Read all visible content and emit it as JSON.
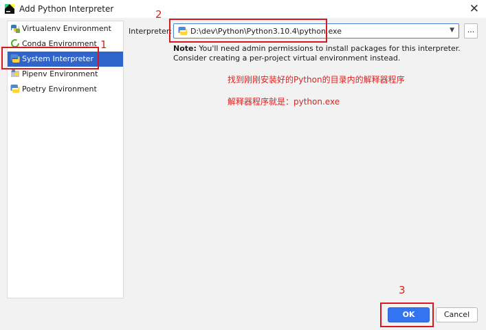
{
  "window": {
    "title": "Add Python Interpreter"
  },
  "sidebar": {
    "items": [
      {
        "label": "Virtualenv Environment",
        "icon": "virtualenv-icon"
      },
      {
        "label": "Conda Environment",
        "icon": "conda-icon"
      },
      {
        "label": "System Interpreter",
        "icon": "python-icon",
        "selected": true
      },
      {
        "label": "Pipenv Environment",
        "icon": "pipenv-icon"
      },
      {
        "label": "Poetry Environment",
        "icon": "poetry-icon"
      }
    ]
  },
  "form": {
    "interpreter_label": "Interpreter:",
    "interpreter_value": "D:\\dev\\Python\\Python3.10.4\\python.exe",
    "browse_label": "...",
    "note_bold": "Note:",
    "note_text": " You'll need admin permissions to install packages for this interpreter. Consider creating a per-project virtual environment instead."
  },
  "annotations": {
    "line1": "找到刚刚安装好的Python的目录内的解释器程序",
    "line2": "解释器程序就是：python.exe",
    "num1": "1",
    "num2": "2",
    "num3": "3"
  },
  "buttons": {
    "ok": "OK",
    "cancel": "Cancel"
  },
  "colors": {
    "accent": "#3574f0",
    "selection": "#2f65ca",
    "annotation": "#e0201c"
  }
}
